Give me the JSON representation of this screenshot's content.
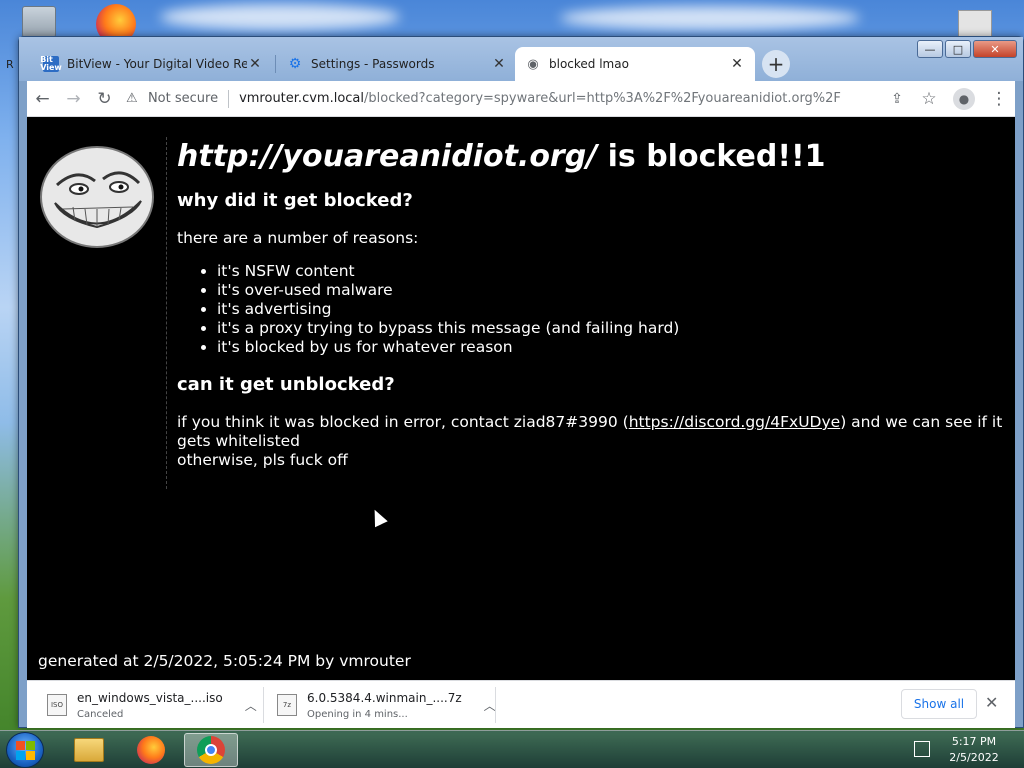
{
  "window": {
    "controls": {
      "minimize": "—",
      "maximize": "□",
      "close": "✕"
    }
  },
  "tabs": [
    {
      "title": "BitView - Your Digital Video Repository",
      "icon": "bitview-icon",
      "icon_text": "Bit View",
      "active": false
    },
    {
      "title": "Settings - Passwords",
      "icon": "gear-icon",
      "active": false
    },
    {
      "title": "blocked lmao",
      "icon": "globe-icon",
      "active": true
    }
  ],
  "new_tab_label": "+",
  "toolbar": {
    "security_label": "Not secure",
    "url_host": "vmrouter.cvm.local",
    "url_rest": "/blocked?category=spyware&url=http%3A%2F%2Fyouareanidiot.org%2F"
  },
  "page": {
    "heading_url": "http://youareanidiot.org/",
    "heading_rest": " is blocked!!1",
    "why_heading": "why did it get blocked?",
    "intro": "there are a number of reasons:",
    "reasons": [
      "it's NSFW content",
      "it's over-used malware",
      "it's advertising",
      "it's a proxy trying to bypass this message (and failing hard)",
      "it's blocked by us for whatever reason"
    ],
    "unblock_heading": "can it get unblocked?",
    "unblock_text_1": "if you think it was blocked in error, contact ziad87#3990 (",
    "unblock_link": "https://discord.gg/4FxUDye",
    "unblock_text_2": ") and we can see if it gets whitelisted",
    "unblock_text_3": "otherwise, pls fuck off",
    "generated": "generated at 2/5/2022, 5:05:24 PM by vmrouter"
  },
  "downloads": {
    "items": [
      {
        "name": "en_windows_vista_....iso",
        "status": "Canceled",
        "icon_text": "ISO"
      },
      {
        "name": "6.0.5384.4.winmain_....7z",
        "status": "Opening in 4 mins...",
        "icon_text": "7z"
      }
    ],
    "show_all": "Show all"
  },
  "taskbar": {
    "time": "5:17 PM",
    "date": "2/5/2022"
  },
  "desktop": {
    "left_letter": "R"
  },
  "colors": {
    "page_bg": "#000000",
    "page_text": "#ffffff",
    "link": "#1a73e8"
  }
}
